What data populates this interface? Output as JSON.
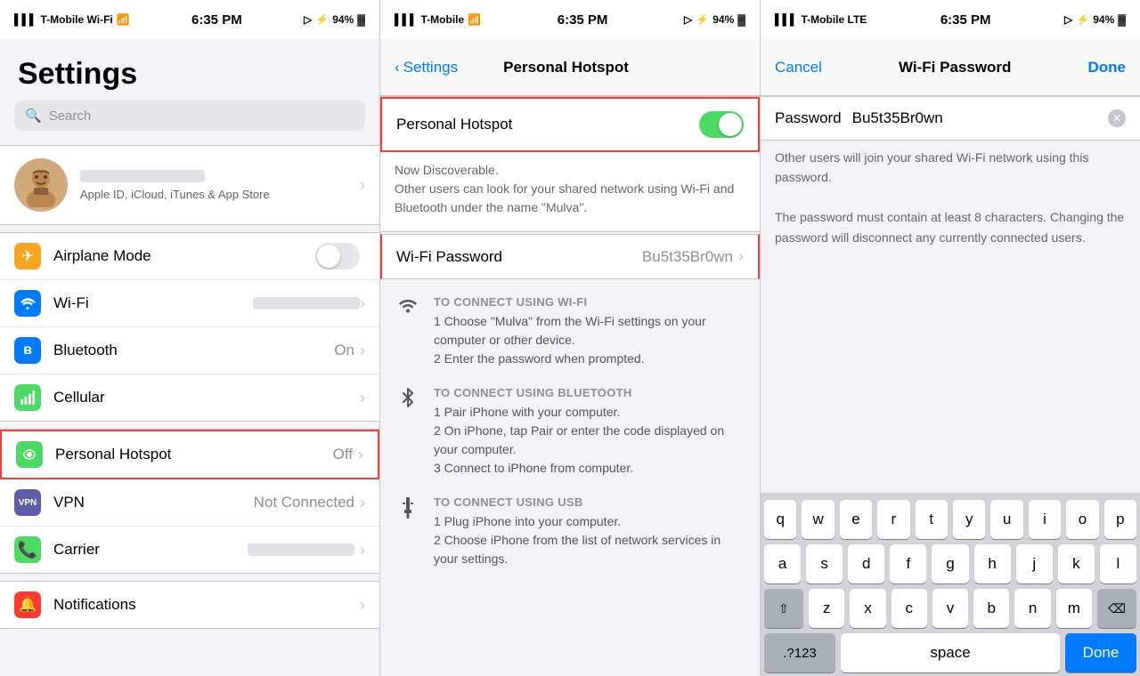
{
  "panel1": {
    "status_bar": {
      "carrier": "T-Mobile Wi-Fi",
      "time": "6:35 PM",
      "battery": "94%"
    },
    "title": "Settings",
    "search_placeholder": "Search",
    "profile": {
      "subtitle": "Apple ID, iCloud, iTunes & App Store"
    },
    "items": [
      {
        "id": "airplane",
        "label": "Airplane Mode",
        "value": "",
        "has_toggle": true,
        "icon_class": "icon-airplane",
        "icon": "✈"
      },
      {
        "id": "wifi",
        "label": "Wi-Fi",
        "value": "blurred",
        "icon_class": "icon-wifi",
        "icon": "📶"
      },
      {
        "id": "bluetooth",
        "label": "Bluetooth",
        "value": "On",
        "icon_class": "icon-bluetooth",
        "icon": "🔷"
      },
      {
        "id": "cellular",
        "label": "Cellular",
        "value": "",
        "icon_class": "icon-cellular",
        "icon": "📡"
      }
    ],
    "items2": [
      {
        "id": "hotspot",
        "label": "Personal Hotspot",
        "value": "Off",
        "highlighted": true,
        "icon_class": "icon-hotspot",
        "icon": "🔗"
      },
      {
        "id": "vpn",
        "label": "VPN",
        "value": "Not Connected",
        "icon_class": "icon-vpn",
        "icon": "VPN"
      },
      {
        "id": "carrier",
        "label": "Carrier",
        "value": "blurred",
        "icon_class": "icon-carrier",
        "icon": "📞"
      }
    ],
    "items3": [
      {
        "id": "notifications",
        "label": "Notifications",
        "value": "",
        "icon_class": "icon-notifications",
        "icon": "🔔"
      }
    ]
  },
  "panel2": {
    "status_bar": {
      "carrier": "T-Mobile",
      "time": "6:35 PM",
      "battery": "94%"
    },
    "nav": {
      "back_label": "Settings",
      "title": "Personal Hotspot"
    },
    "hotspot_toggle": {
      "label": "Personal Hotspot",
      "enabled": true
    },
    "discoverable_text": "Now Discoverable.\nOther users can look for your shared network using Wi-Fi and Bluetooth under the name \"Mulva\".",
    "wifi_password": {
      "label": "Wi-Fi Password",
      "value": "Bu5t35Br0wn"
    },
    "connect_sections": [
      {
        "type": "wifi",
        "header": "TO CONNECT USING WI-FI",
        "instructions": "1 Choose \"Mulva\" from the Wi-Fi settings on your computer or other device.\n2 Enter the password when prompted."
      },
      {
        "type": "bluetooth",
        "header": "TO CONNECT USING BLUETOOTH",
        "instructions": "1 Pair iPhone with your computer.\n2 On iPhone, tap Pair or enter the code displayed on your computer.\n3 Connect to iPhone from computer."
      },
      {
        "type": "usb",
        "header": "TO CONNECT USING USB",
        "instructions": "1 Plug iPhone into your computer.\n2 Choose iPhone from the list of network services in your settings."
      }
    ]
  },
  "panel3": {
    "status_bar": {
      "carrier": "T-Mobile LTE",
      "time": "6:35 PM",
      "battery": "94%"
    },
    "nav": {
      "cancel_label": "Cancel",
      "title": "Wi-Fi Password",
      "done_label": "Done"
    },
    "password_field": {
      "label": "Password",
      "value": "Bu5t35Br0wn"
    },
    "hint_text": "Other users will join your shared Wi-Fi network using this password.\n\nThe password must contain at least 8 characters. Changing the password will disconnect any currently connected users.",
    "keyboard": {
      "rows": [
        [
          "q",
          "w",
          "e",
          "r",
          "t",
          "y",
          "u",
          "i",
          "o",
          "p"
        ],
        [
          "a",
          "s",
          "d",
          "f",
          "g",
          "h",
          "j",
          "k",
          "l"
        ],
        [
          "z",
          "x",
          "c",
          "v",
          "b",
          "n",
          "m"
        ]
      ],
      "special": {
        "numbers": ".?123",
        "space": "space",
        "done": "Done"
      }
    }
  }
}
